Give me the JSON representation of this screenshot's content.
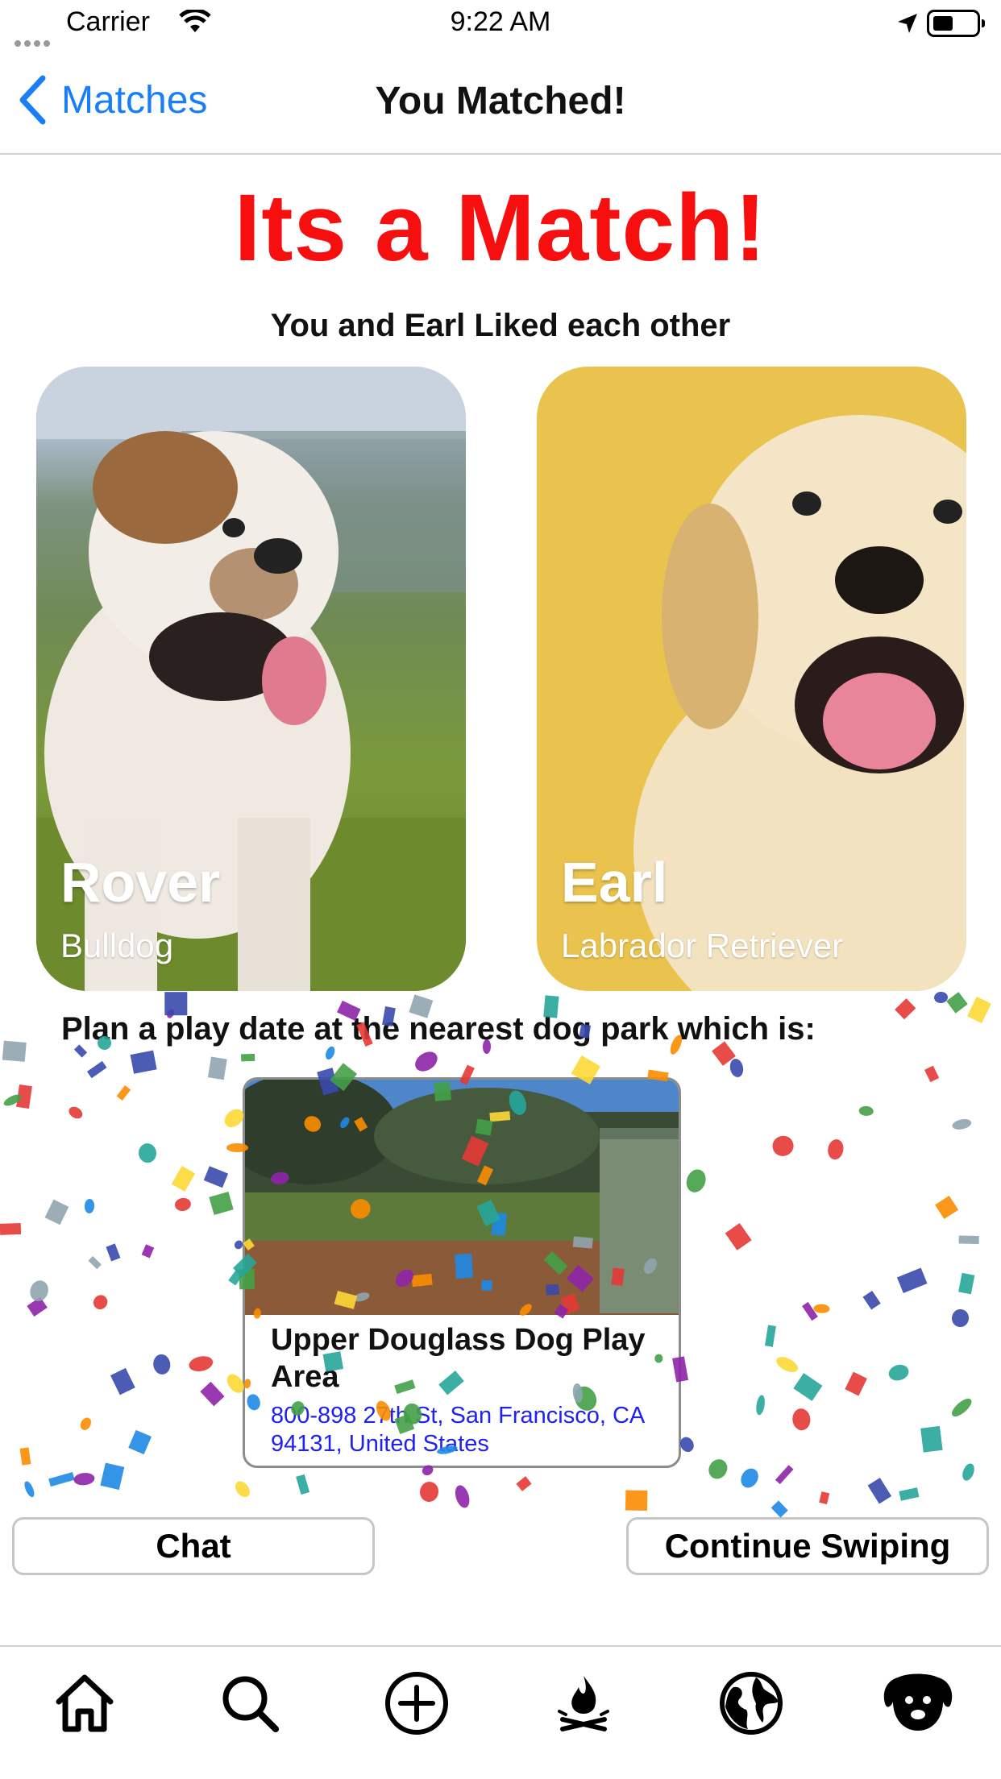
{
  "status_bar": {
    "carrier": "Carrier",
    "time": "9:22 AM"
  },
  "nav": {
    "back_label": "Matches",
    "title": "You Matched!"
  },
  "match": {
    "headline": "Its a Match!",
    "subtitle": "You and Earl Liked each other"
  },
  "dogs": [
    {
      "name": "Rover",
      "breed": "Bulldog"
    },
    {
      "name": "Earl",
      "breed": "Labrador Retriever"
    }
  ],
  "park": {
    "prompt": "Plan a play date at the nearest dog park which is:",
    "name": "Upper Douglass Dog Play Area",
    "address": "800-898 27th St, San Francisco, CA 94131, United States"
  },
  "actions": {
    "chat_label": "Chat",
    "continue_label": "Continue Swiping"
  },
  "tabbar": {
    "items": [
      "home-icon",
      "search-icon",
      "add-icon",
      "campfire-icon",
      "globe-icon",
      "dog-icon"
    ]
  },
  "colors": {
    "accent": "#1a7ef7",
    "headline": "#f70f0f",
    "address": "#1f21f0"
  }
}
